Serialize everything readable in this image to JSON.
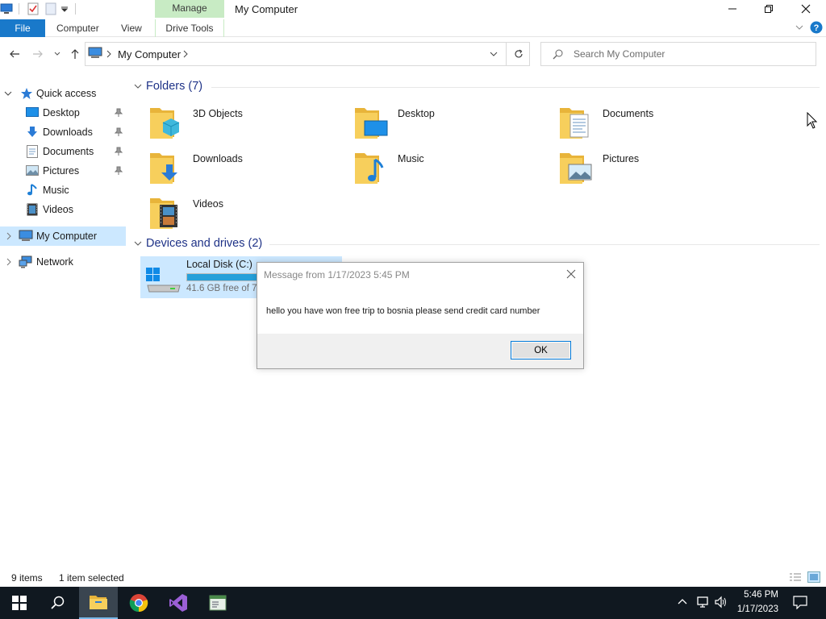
{
  "window": {
    "title": "My Computer",
    "context_tab_group": "Manage"
  },
  "ribbon": {
    "tabs": [
      "File",
      "Computer",
      "View",
      "Drive Tools"
    ]
  },
  "address": {
    "path": "My Computer",
    "search_placeholder": "Search My Computer"
  },
  "nav": {
    "quick_access": "Quick access",
    "items": [
      {
        "label": "Desktop",
        "icon": "desktop-icon",
        "pinned": true
      },
      {
        "label": "Downloads",
        "icon": "downloads-icon",
        "pinned": true
      },
      {
        "label": "Documents",
        "icon": "documents-icon",
        "pinned": true
      },
      {
        "label": "Pictures",
        "icon": "pictures-icon",
        "pinned": true
      },
      {
        "label": "Music",
        "icon": "music-icon",
        "pinned": false
      },
      {
        "label": "Videos",
        "icon": "videos-icon",
        "pinned": false
      }
    ],
    "my_computer": "My Computer",
    "network": "Network"
  },
  "content": {
    "folders_header": "Folders (7)",
    "folders": [
      {
        "name": "3D Objects",
        "overlay": "cube-icon"
      },
      {
        "name": "Desktop",
        "overlay": "desktop-icon"
      },
      {
        "name": "Documents",
        "overlay": "document-icon"
      },
      {
        "name": "Downloads",
        "overlay": "download-arrow-icon"
      },
      {
        "name": "Music",
        "overlay": "music-note-icon"
      },
      {
        "name": "Pictures",
        "overlay": "landscape-icon"
      },
      {
        "name": "Videos",
        "overlay": "film-icon"
      }
    ],
    "drives_header": "Devices and drives (2)",
    "drive": {
      "name": "Local Disk (C:)",
      "free_text": "41.6 GB free of 79",
      "used_fraction": 0.47
    }
  },
  "dialog": {
    "title": "Message from  1/17/2023 5:45 PM",
    "message": "hello you have won free trip to bosnia please send credit card number",
    "ok_label": "OK"
  },
  "status": {
    "items": "9 items",
    "selected": "1 item selected"
  },
  "taskbar": {
    "time": "5:46 PM",
    "date": "1/17/2023"
  },
  "colors": {
    "accent": "#1979ca",
    "selection": "#cce8ff",
    "context_tab": "#c8ebc4",
    "taskbar": "#101820",
    "header_text": "#1e3287",
    "folder": "#f5c84c"
  }
}
